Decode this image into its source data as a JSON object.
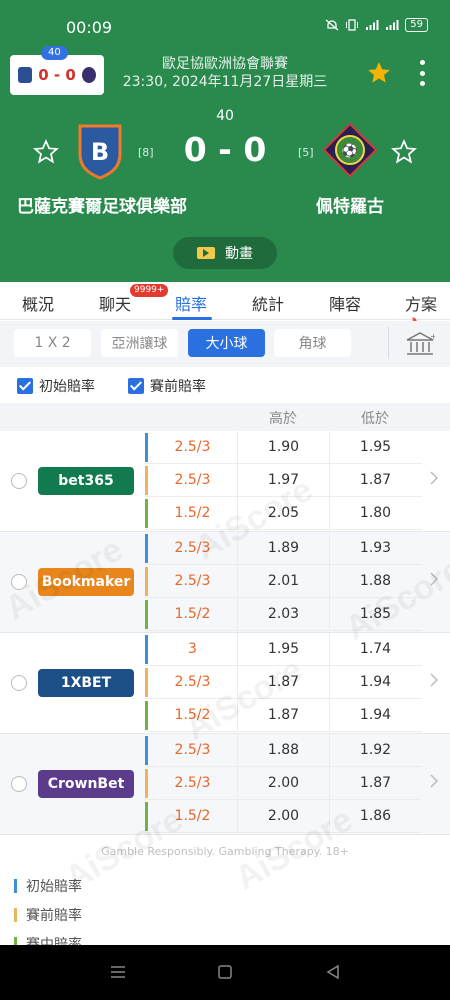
{
  "status_bar": {
    "time": "00:09",
    "battery": "59"
  },
  "mini_score": {
    "minute": "40",
    "score": "0 - 0"
  },
  "league": {
    "name": "歐足協歐洲協會聯賽",
    "datetime": "23:30, 2024年11月27日星期三"
  },
  "match": {
    "minute": "40",
    "score": "0 - 0",
    "home": {
      "name": "巴薩克賽爾足球俱樂部",
      "rank": "[8]"
    },
    "away": {
      "name": "佩特羅古",
      "rank": "[5]"
    }
  },
  "animation_button": "動畫",
  "tabs": [
    {
      "label": "概況"
    },
    {
      "label": "聊天",
      "badge": "9999+"
    },
    {
      "label": "賠率"
    },
    {
      "label": "統計"
    },
    {
      "label": "陣容"
    },
    {
      "label": "方案"
    }
  ],
  "markets": [
    "1 X 2",
    "亞洲讓球",
    "大小球",
    "角球"
  ],
  "checks": [
    "初始賠率",
    "賽前賠率"
  ],
  "table_header": {
    "over": "高於",
    "under": "低於"
  },
  "bookmakers": [
    {
      "name": "bet365",
      "color": "#117a4e",
      "rows": [
        {
          "line": "2.5/3",
          "over": "1.90",
          "under": "1.95"
        },
        {
          "line": "2.5/3",
          "over": "1.97",
          "under": "1.87"
        },
        {
          "line": "1.5/2",
          "over": "2.05",
          "under": "1.80"
        }
      ]
    },
    {
      "name": "Bookmaker",
      "color": "#e8861c",
      "rows": [
        {
          "line": "2.5/3",
          "over": "1.89",
          "under": "1.93"
        },
        {
          "line": "2.5/3",
          "over": "2.01",
          "under": "1.88"
        },
        {
          "line": "1.5/2",
          "over": "2.03",
          "under": "1.85"
        }
      ]
    },
    {
      "name": "1XBET",
      "color": "#1c4f86",
      "rows": [
        {
          "line": "3",
          "over": "1.95",
          "under": "1.74"
        },
        {
          "line": "2.5/3",
          "over": "1.87",
          "under": "1.94"
        },
        {
          "line": "1.5/2",
          "over": "1.87",
          "under": "1.94"
        }
      ]
    },
    {
      "name": "CrownBet",
      "color": "#5b3b8c",
      "rows": [
        {
          "line": "2.5/3",
          "over": "1.88",
          "under": "1.92"
        },
        {
          "line": "2.5/3",
          "over": "2.00",
          "under": "1.87"
        },
        {
          "line": "1.5/2",
          "over": "2.00",
          "under": "1.86"
        }
      ]
    }
  ],
  "disclaimer": "Gamble Responsibly. Gambling Therapy. 18+",
  "legend": [
    {
      "label": "初始賠率",
      "color": "#3d8fd6"
    },
    {
      "label": "賽前賠率",
      "color": "#f0b35c"
    },
    {
      "label": "賽中賠率",
      "color": "#6fb345"
    }
  ],
  "watermark": "AiScore"
}
